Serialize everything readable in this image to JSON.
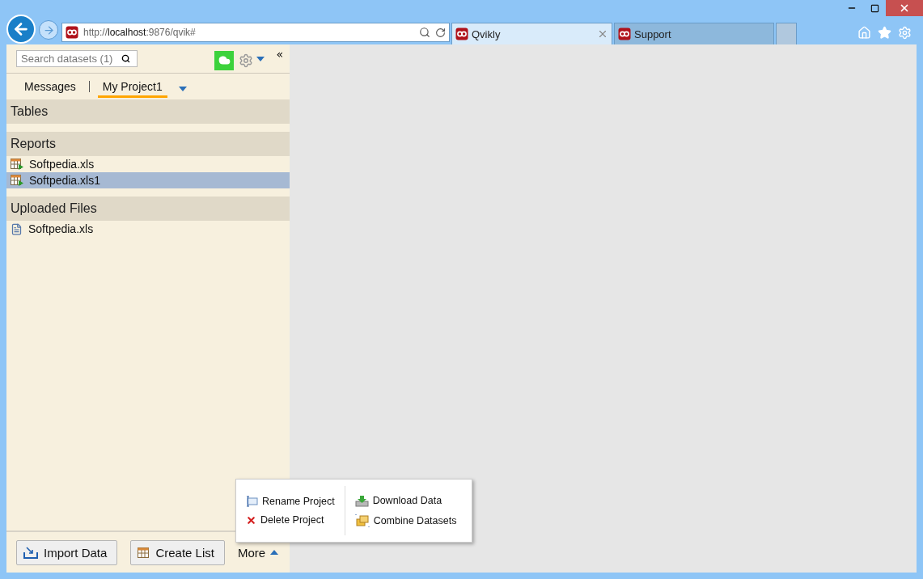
{
  "browser": {
    "url": "http://**localhost**:9876/qvik#",
    "tabs": [
      {
        "label": "Qvikly",
        "selected": true
      },
      {
        "label": "Support",
        "selected": false
      }
    ]
  },
  "sidebar": {
    "search": {
      "placeholder": "Search datasets (1)"
    },
    "collapse": "«",
    "project_tabs": [
      {
        "label": "Messages",
        "selected": false
      },
      {
        "label": "My Project1",
        "selected": true
      }
    ],
    "sections": [
      {
        "title": "Tables"
      },
      {
        "title": "Reports",
        "items": [
          {
            "label": "Softpedia.xls",
            "kind": "report",
            "selected": false
          },
          {
            "label": "Softpedia.xls1",
            "kind": "report",
            "selected": true
          }
        ]
      },
      {
        "title": "Uploaded Files",
        "items": [
          {
            "label": "Softpedia.xls",
            "kind": "file",
            "selected": false
          }
        ]
      }
    ],
    "footer_buttons": [
      {
        "label": "Import Data",
        "kind": "import"
      },
      {
        "label": "Create List",
        "kind": "list"
      }
    ],
    "more": {
      "label": "More",
      "expanded": true
    }
  },
  "more_menu": [
    [
      {
        "label": "Rename Project",
        "kind": "rename"
      },
      {
        "label": "Delete Project",
        "kind": "delete"
      }
    ],
    [
      {
        "label": "Download Data",
        "kind": "download"
      },
      {
        "label": "Combine Datasets",
        "kind": "combine"
      }
    ]
  ]
}
